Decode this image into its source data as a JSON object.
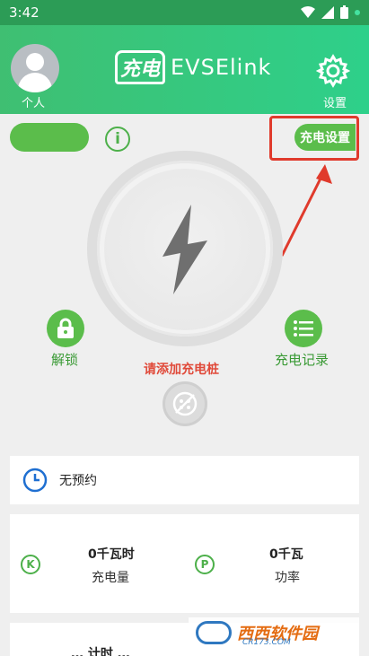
{
  "status_bar": {
    "time": "3:42"
  },
  "header": {
    "profile_label": "个人",
    "logo_mark": "充电",
    "logo_text": "EVSElink",
    "settings_label": "设置"
  },
  "controls": {
    "charge_settings_label": "充电设置",
    "unlock_label": "解锁",
    "records_label": "充电记录",
    "add_pile_text": "请添加充电桩"
  },
  "reservation": {
    "label": "无预约"
  },
  "stats": {
    "energy_value": "0千瓦时",
    "energy_label": "充电量",
    "energy_icon": "K",
    "power_value": "0千瓦",
    "power_label": "功率",
    "power_icon": "P"
  },
  "bottom_card": {
    "text": "… 计时 …"
  },
  "watermark": {
    "text": "西西软件园",
    "sub": "CR173.COM"
  },
  "colors": {
    "brand_green": "#5bbd4b",
    "highlight_red": "#e03a2c",
    "warning_red": "#e04a3a"
  }
}
